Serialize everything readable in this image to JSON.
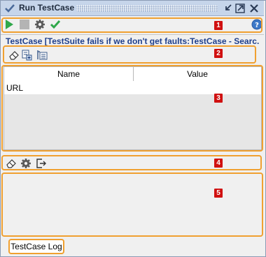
{
  "window": {
    "title": "Run TestCase"
  },
  "toolbar": {
    "run_icon": "play-icon",
    "stop_icon": "stop-icon",
    "options_icon": "gear-icon",
    "validate_icon": "checkmark-icon",
    "help_icon": "help-icon"
  },
  "testcase": {
    "heading": "TestCase [TestSuite fails if we don't get faults:TestCase - Searc..."
  },
  "properties": {
    "columns": [
      "Name",
      "Value"
    ],
    "rows": [
      {
        "name": "URL",
        "value": ""
      }
    ]
  },
  "tabs": {
    "log_label": "TestCase Log"
  },
  "annotations": [
    "1",
    "2",
    "3",
    "4",
    "5"
  ],
  "colors": {
    "highlight": "#f0a030",
    "badge": "#d01010",
    "title_bar": "#c6d5ea",
    "heading_text": "#1f3f8c"
  }
}
